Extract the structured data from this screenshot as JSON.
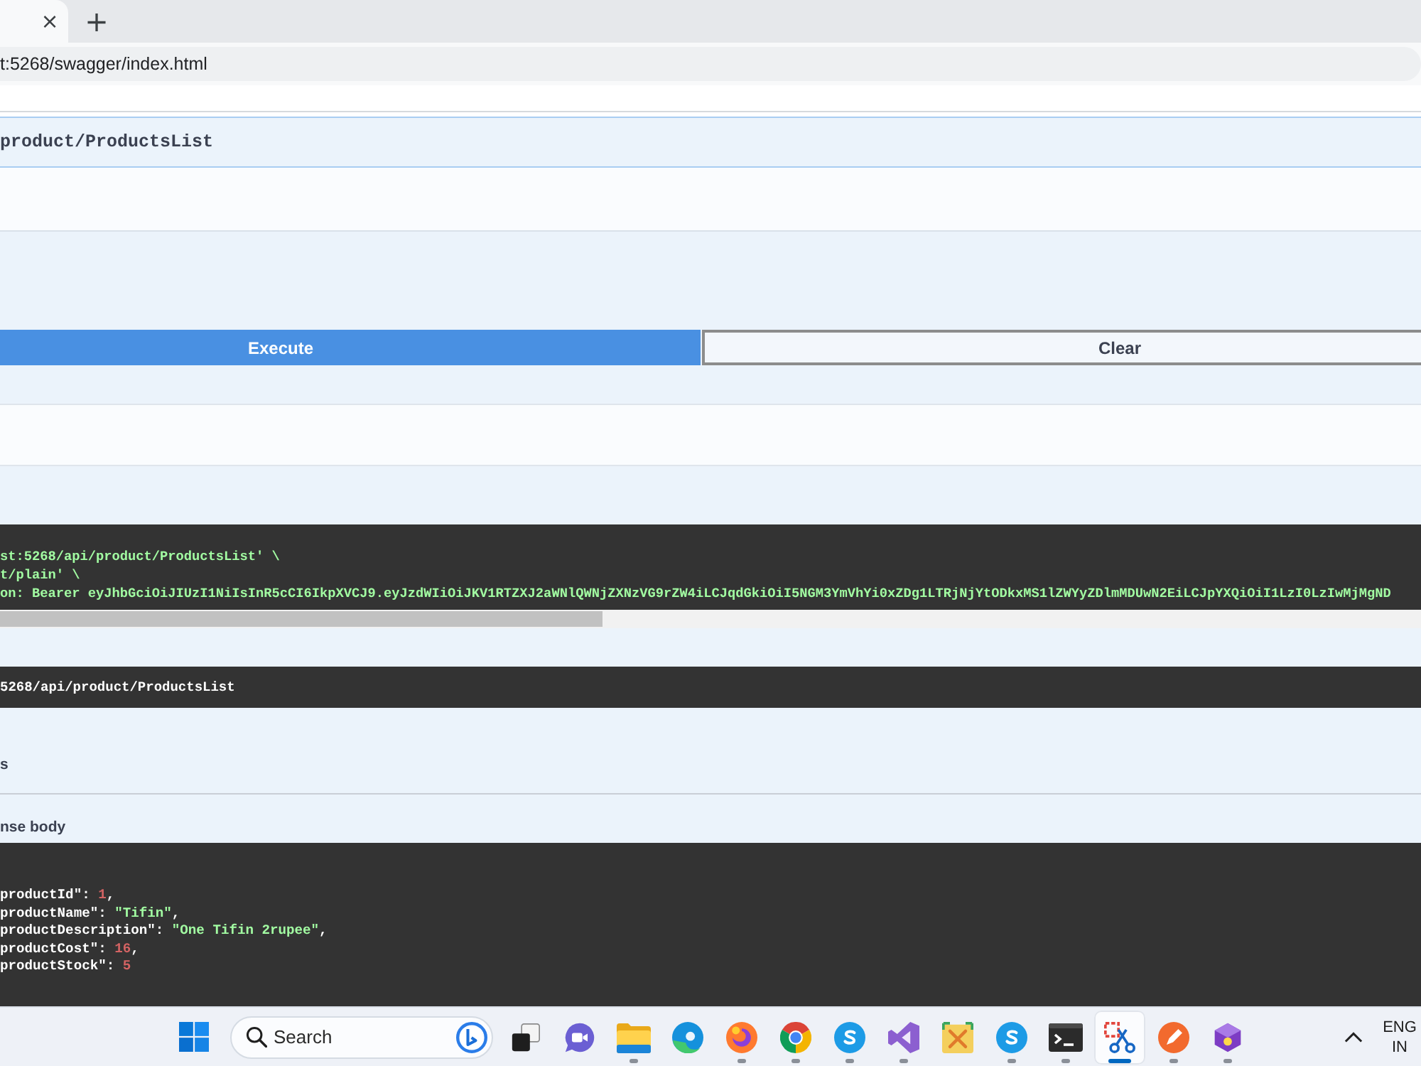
{
  "browser": {
    "tabs": [
      {
        "close": "×",
        "selected": true
      }
    ],
    "new_tab": "+",
    "address": "t:5268/swagger/index.html"
  },
  "operation": {
    "path": "product/ProductsList",
    "buttons": [
      {
        "label": "Execute",
        "kind": "primary"
      },
      {
        "label": "Clear",
        "kind": "secondary"
      }
    ]
  },
  "curl": {
    "lines": [
      "st:5268/api/product/ProductsList' \\",
      "t/plain' \\",
      "on: Bearer eyJhbGciOiJIUzI1NiIsInR5cCI6IkpXVCJ9.eyJzdWIiOiJKV1RTZXJ2aWNlQWNjZXNzVG9rZW4iLCJqdGkiOiI5NGM3YmVhYi0xZDg1LTRjNjYtODkxMS1lZWYyZDlmMDUwN2EiLCJpYXQiOiI1LzI0LzIwMjMgND"
    ]
  },
  "request_url": "5268/api/product/ProductsList",
  "server_response": {
    "column_2": "s"
  },
  "response_body": {
    "label": "nse body",
    "lines": [
      {
        "key": "productId\": ",
        "value": "1",
        "kind": "number",
        "end": ","
      },
      {
        "key": "productName\": ",
        "value": "\"Tifin\"",
        "kind": "string",
        "end": ","
      },
      {
        "key": "productDescription\": ",
        "value": "\"One Tifin 2rupee\"",
        "kind": "string",
        "end": ","
      },
      {
        "key": "productCost\": ",
        "value": "16",
        "kind": "number",
        "end": ","
      },
      {
        "key": "productStock\": ",
        "value": "5",
        "kind": "number"
      }
    ]
  },
  "taskbar": {
    "search": {
      "placeholder": "Search"
    },
    "apps": [
      {
        "kind": "taskview",
        "running": false,
        "selected": false
      },
      {
        "kind": "chat",
        "running": false,
        "selected": false
      },
      {
        "kind": "folder",
        "running": true,
        "selected": false
      },
      {
        "kind": "swirl",
        "running": false,
        "selected": false
      },
      {
        "kind": "flame",
        "running": true,
        "selected": false
      },
      {
        "kind": "segmented",
        "running": true,
        "selected": false
      },
      {
        "kind": "swoosh",
        "running": true,
        "selected": false
      },
      {
        "kind": "ribbon",
        "running": true,
        "selected": false
      },
      {
        "kind": "tools",
        "running": false,
        "selected": false
      },
      {
        "kind": "swoosh",
        "running": true,
        "selected": false
      },
      {
        "kind": "terminal",
        "running": true,
        "selected": false
      },
      {
        "kind": "scissors",
        "running": true,
        "selected": true
      },
      {
        "kind": "pen",
        "running": true,
        "selected": false
      },
      {
        "kind": "package",
        "running": true,
        "selected": false
      }
    ],
    "language": {
      "code": "ENG",
      "region": "IN"
    }
  }
}
